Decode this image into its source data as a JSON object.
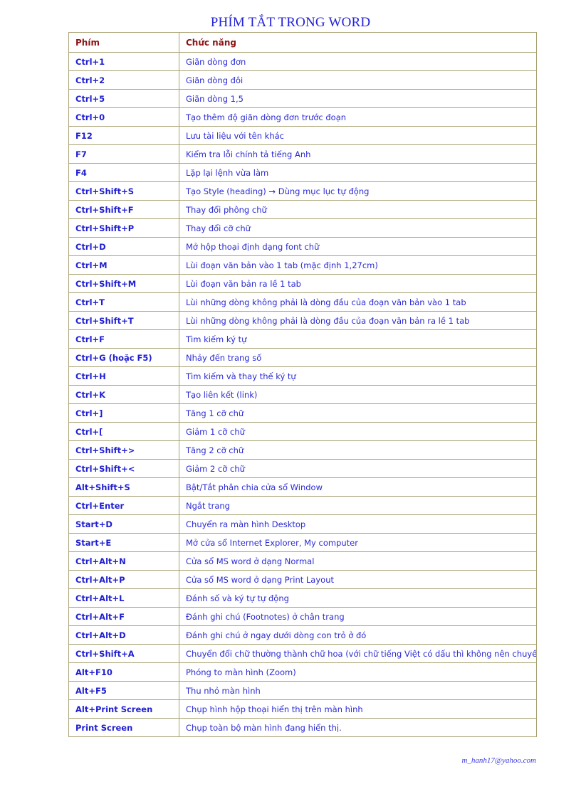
{
  "document": {
    "title": "PHÍM TẮT TRONG WORD",
    "footer_email": "m_hanh17@yahoo.com",
    "colors": {
      "title": "#2323d8",
      "header_text": "#8c1414",
      "key_text": "#1e1ed2",
      "function_text": "#2a2ad4",
      "border": "#a8a273",
      "page_background": "#ffffff"
    }
  },
  "table": {
    "headers": {
      "key": "Phím",
      "function": "Chức năng"
    },
    "rows": [
      {
        "key": "Ctrl+1",
        "function": "Giãn dòng đơn"
      },
      {
        "key": "Ctrl+2",
        "function": "Giãn dòng đôi"
      },
      {
        "key": "Ctrl+5",
        "function": "Giãn dòng 1,5"
      },
      {
        "key": "Ctrl+0",
        "function": "Tạo thêm độ giãn dòng đơn trước đoạn"
      },
      {
        "key": "F12",
        "function": "Lưu tài liệu với tên khác"
      },
      {
        "key": "F7",
        "function": "Kiểm tra lỗi chính tả tiếng Anh"
      },
      {
        "key": "F4",
        "function": "Lặp lại lệnh vừa làm"
      },
      {
        "key": "Ctrl+Shift+S",
        "function": "Tạo Style (heading) → Dùng mục lục tự động"
      },
      {
        "key": "Ctrl+Shift+F",
        "function": "Thay đổi phông chữ"
      },
      {
        "key": "Ctrl+Shift+P",
        "function": "Thay đổi cỡ chữ"
      },
      {
        "key": "Ctrl+D",
        "function": "Mở hộp thoại định dạng font chữ"
      },
      {
        "key": "Ctrl+M",
        "function": "Lùi đoạn văn bản vào 1 tab (mặc định 1,27cm)"
      },
      {
        "key": "Ctrl+Shift+M",
        "function": "Lùi đoạn văn bản ra lề 1 tab"
      },
      {
        "key": "Ctrl+T",
        "function": "Lùi những dòng không phải là dòng đầu của đoạn văn bản vào 1 tab"
      },
      {
        "key": "Ctrl+Shift+T",
        "function": "Lùi những dòng không phải là dòng đầu của đoạn văn bản ra lề 1 tab"
      },
      {
        "key": "Ctrl+F",
        "function": "Tìm kiếm ký tự"
      },
      {
        "key": "Ctrl+G (hoặc F5)",
        "function": "Nhảy đến trang số"
      },
      {
        "key": "Ctrl+H",
        "function": "Tìm kiếm và thay thế ký tự"
      },
      {
        "key": "Ctrl+K",
        "function": "Tạo liên kết (link)"
      },
      {
        "key": "Ctrl+]",
        "function": "Tăng 1 cỡ chữ"
      },
      {
        "key": "Ctrl+[",
        "function": "Giảm 1 cỡ chữ"
      },
      {
        "key": "Ctrl+Shift+>",
        "function": "Tăng 2 cỡ chữ"
      },
      {
        "key": "Ctrl+Shift+<",
        "function": "Giảm 2 cỡ chữ"
      },
      {
        "key": "Alt+Shift+S",
        "function": "Bật/Tắt phân chia cửa sổ Window"
      },
      {
        "key": "Ctrl+Enter",
        "function": "Ngắt trang"
      },
      {
        "key": "Start+D",
        "function": "Chuyển ra màn hình Desktop"
      },
      {
        "key": "Start+E",
        "function": "Mở cửa sổ Internet Explorer, My computer"
      },
      {
        "key": "Ctrl+Alt+N",
        "function": "Cửa sổ MS word ở dạng Normal"
      },
      {
        "key": "Ctrl+Alt+P",
        "function": "Cửa sổ MS word ở dạng Print Layout"
      },
      {
        "key": "Ctrl+Alt+L",
        "function": "Đánh số và ký tự tự động"
      },
      {
        "key": "Ctrl+Alt+F",
        "function": "Đánh ghi chú (Footnotes) ở chân trang"
      },
      {
        "key": "Ctrl+Alt+D",
        "function": "Đánh ghi chú ở ngay dưới dòng con trỏ ở đó"
      },
      {
        "key": "Ctrl+Shift+A",
        "function": "Chuyển đổi chữ thường thành chữ hoa (với chữ tiếng Việt có dấu thì không nên chuyển)"
      },
      {
        "key": "Alt+F10",
        "function": "Phóng to màn hình (Zoom)"
      },
      {
        "key": "Alt+F5",
        "function": "Thu nhỏ màn hình"
      },
      {
        "key": "Alt+Print Screen",
        "function": "Chụp hình hộp thoại hiển thị trên màn hình"
      },
      {
        "key": "Print Screen",
        "function": "Chụp toàn bộ màn hình đang hiển thị."
      }
    ]
  }
}
